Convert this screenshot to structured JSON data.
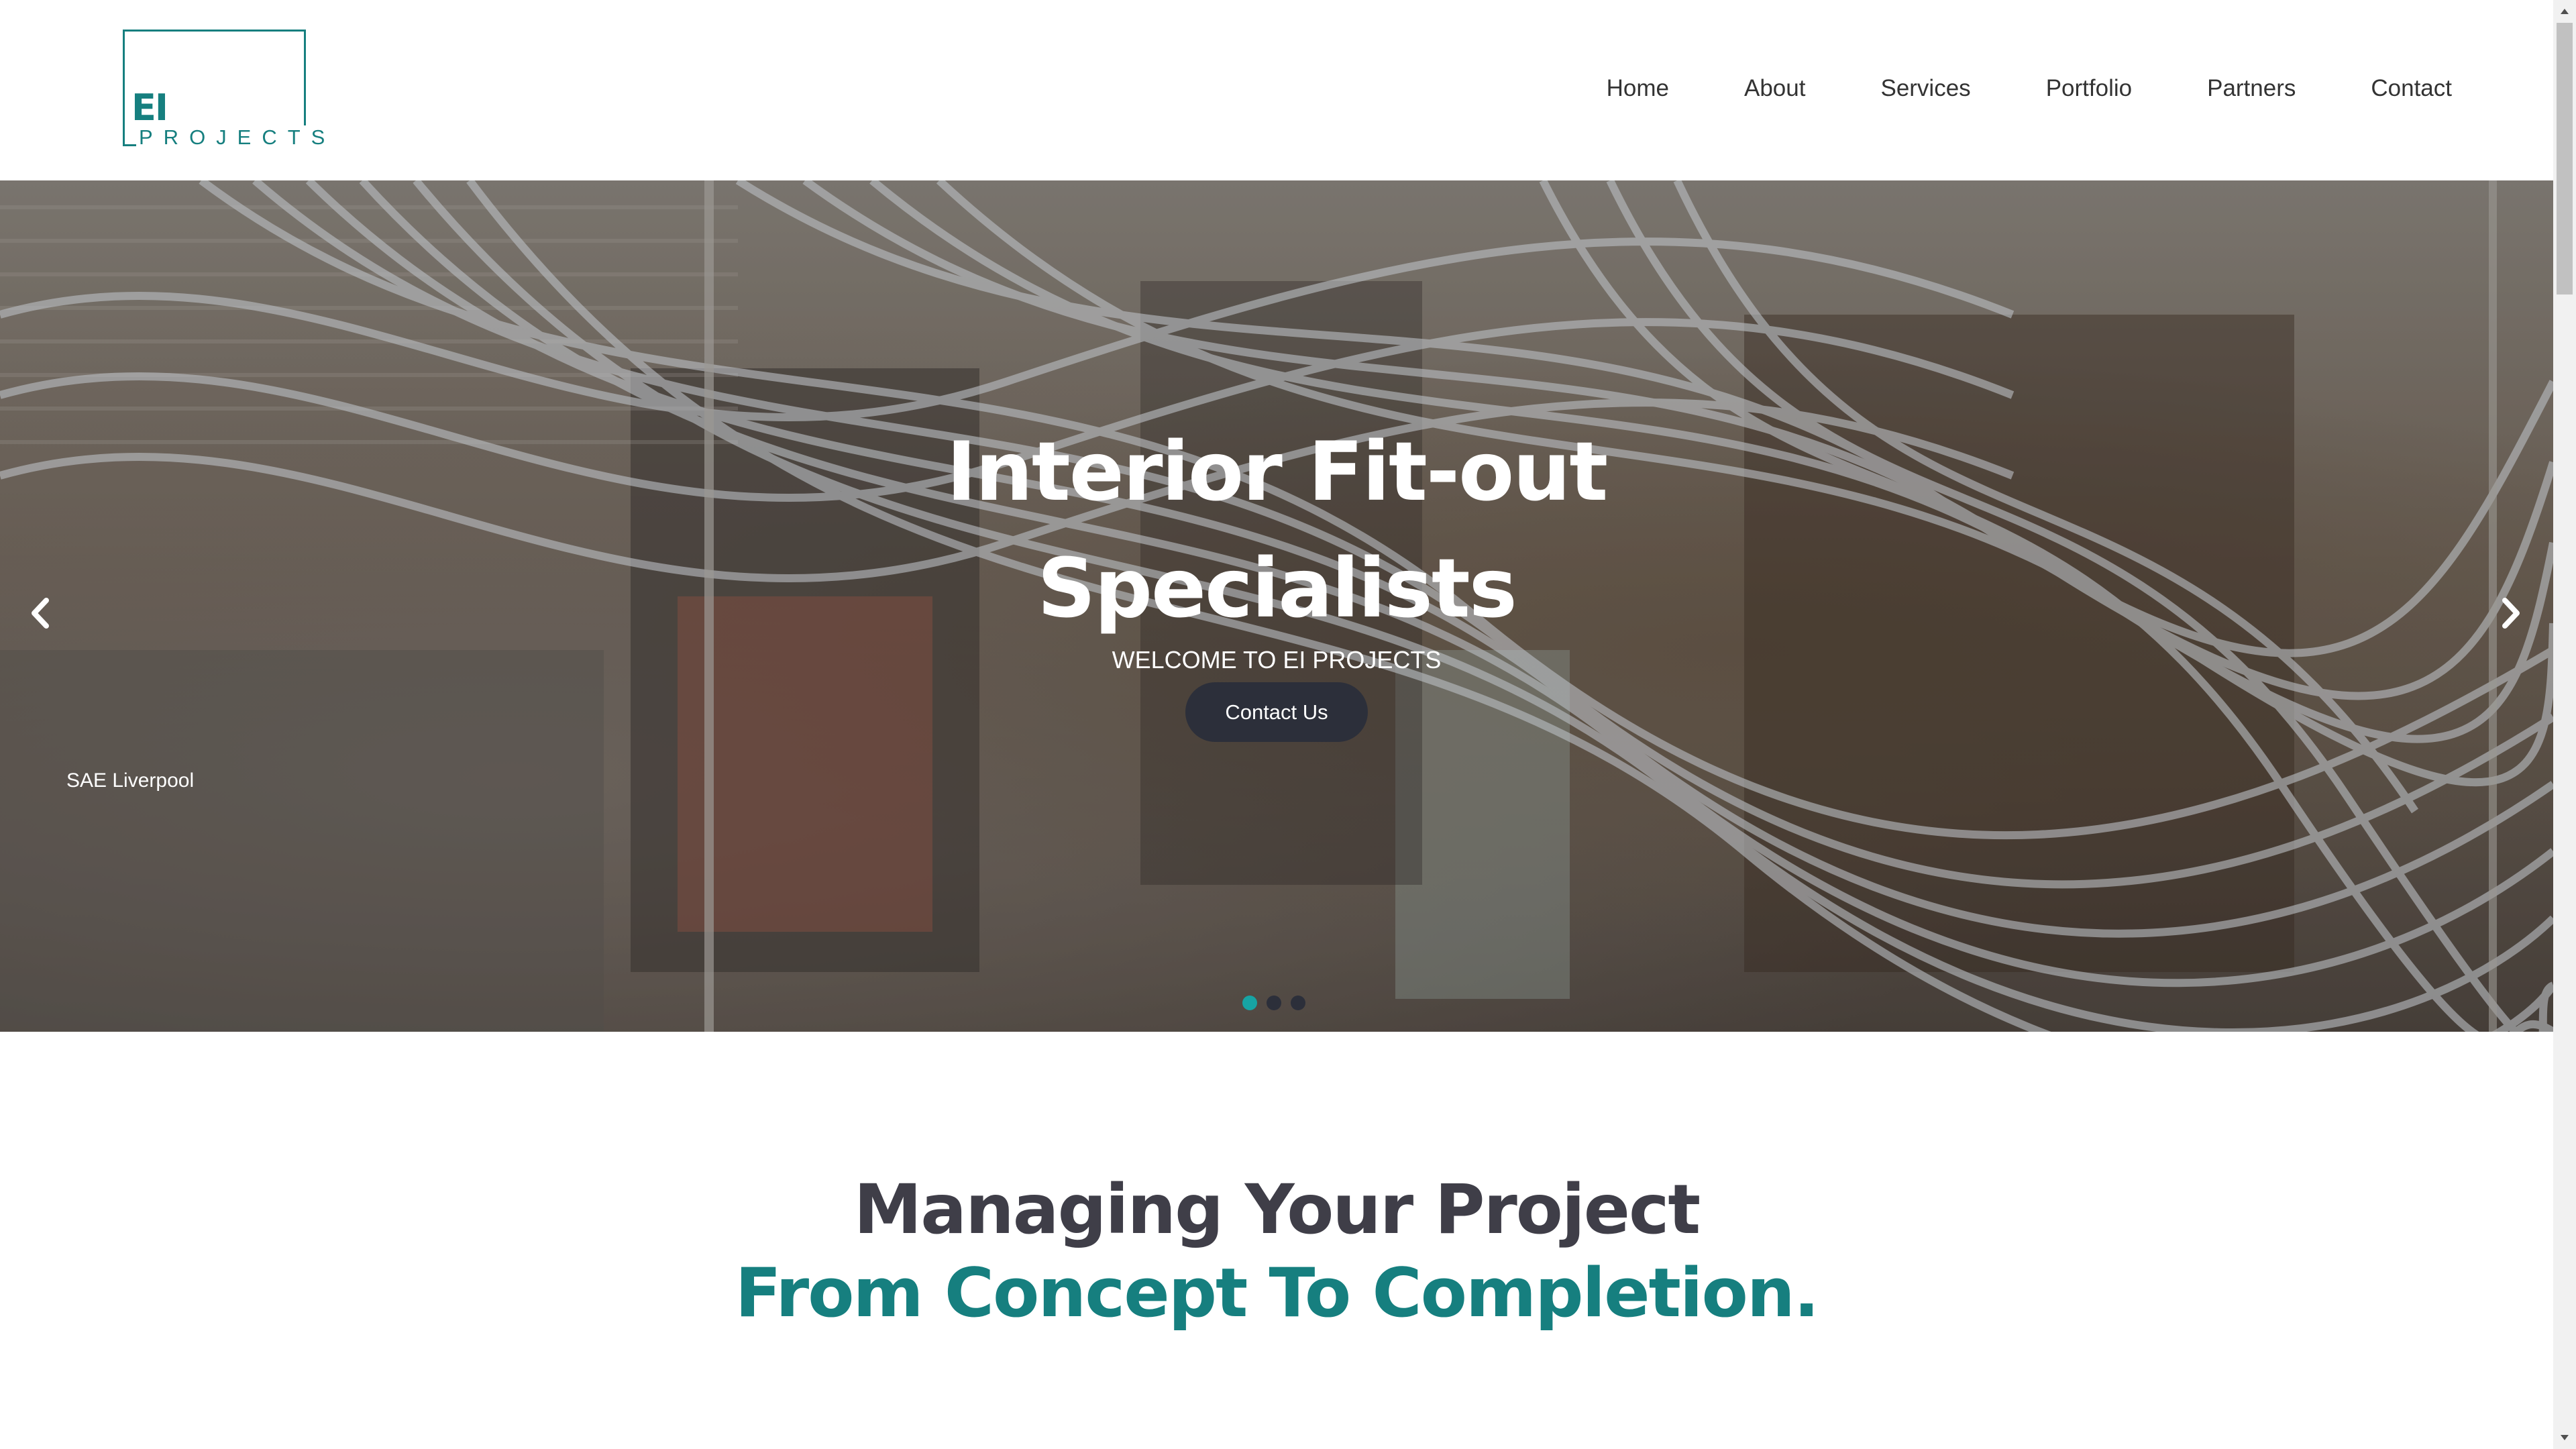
{
  "header": {
    "logo": {
      "mark": "EI",
      "subtext": "PROJECTS"
    },
    "nav": [
      {
        "label": "Home"
      },
      {
        "label": "About"
      },
      {
        "label": "Services"
      },
      {
        "label": "Portfolio"
      },
      {
        "label": "Partners"
      },
      {
        "label": "Contact"
      }
    ]
  },
  "hero": {
    "title_line1": "Interior Fit-out",
    "title_line2": "Specialists",
    "subtitle": "WELCOME TO EI PROJECTS",
    "cta_label": "Contact Us",
    "caption": "SAE Liverpool",
    "prev_icon": "chevron-left-icon",
    "next_icon": "chevron-right-icon",
    "slides_total": 3,
    "active_slide": 1
  },
  "section": {
    "title": "Managing Your Project",
    "subtitle": "From Concept To Completion."
  },
  "colors": {
    "brand_teal": "#167f7f",
    "active_dot": "#17a4a4",
    "dark_button": "#2c2f3a",
    "heading_dark": "#3f3e48"
  }
}
